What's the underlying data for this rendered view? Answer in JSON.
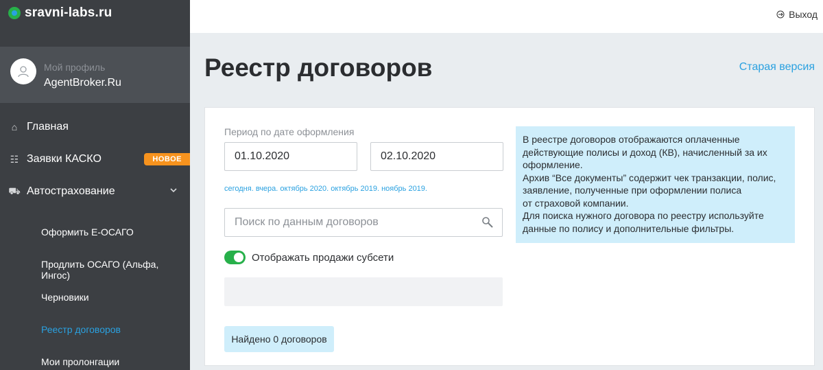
{
  "brand": {
    "name": "sravni-labs.ru"
  },
  "profile": {
    "caption": "Мой профиль",
    "name": "AgentBroker.Ru"
  },
  "nav": {
    "home": "Главная",
    "kasko": "Заявки КАСКО",
    "kasko_badge": "НОВОЕ",
    "auto": "Автострахование",
    "sub": [
      "Оформить Е-ОСАГО",
      "Продлить ОСАГО (Альфа, Ингос)",
      "Черновики",
      "Реестр договоров",
      "Мои пролонгации"
    ]
  },
  "topbar": {
    "logout": "Выход"
  },
  "page": {
    "title": "Реестр договоров",
    "old_version": "Старая версия"
  },
  "filters": {
    "period_label": "Период по дате оформления",
    "date_from": "01.10.2020",
    "date_to": "02.10.2020",
    "quick_links": [
      "сегодня.",
      "вчера.",
      "октябрь 2020.",
      "октябрь 2019.",
      "ноябрь 2019."
    ],
    "search_placeholder": "Поиск по данным договоров",
    "toggle_label": "Отображать продажи субсети",
    "toggle_on": true
  },
  "result": {
    "found": "Найдено 0 договоров"
  },
  "info": {
    "lines": [
      "В реестре договоров отображаются оплаченные",
      "действующие полисы и доход (КВ), начисленный за их",
      "оформление.",
      "Архив “Все документы” содержит чек транзакции, полис,",
      "заявление, полученные при оформлении полиса",
      "от страховой компании.",
      "Для поиска нужного договора по реестру используйте",
      "данные по полису и дополнительные фильтры."
    ]
  },
  "colors": {
    "accent": "#2aa1e0",
    "sidebar": "#3c3f43",
    "badge": "#f7931e",
    "toggle": "#27b04a",
    "info_bg": "#cfeefb"
  }
}
